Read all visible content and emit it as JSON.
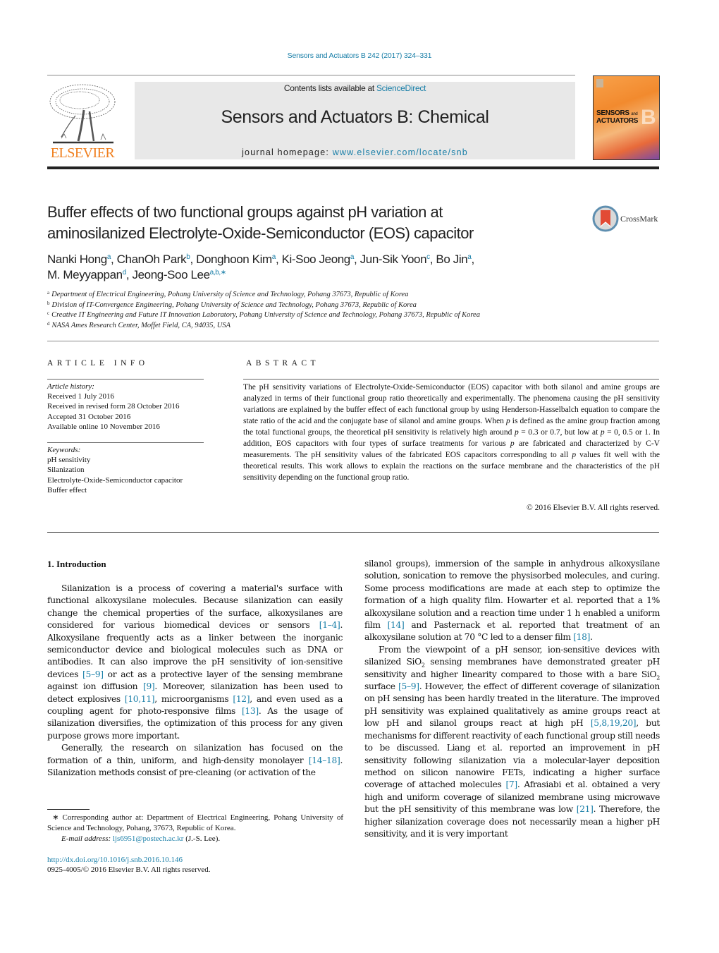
{
  "header": {
    "journal_reference": "Sensors and Actuators B 242 (2017) 324–331",
    "contents_prefix": "Contents lists available at ",
    "contents_link": "ScienceDirect",
    "journal_title": "Sensors and Actuators B: Chemical",
    "homepage_prefix": "journal homepage: ",
    "homepage_link": "www.elsevier.com/locate/snb",
    "publisher_logo_text": "ELSEVIER",
    "cover": {
      "line1": "SENSORS",
      "line1_small": "and",
      "line2": "ACTUATORS",
      "letter": "B"
    },
    "colors": {
      "link": "#1a7fa8",
      "elsevier_orange": "#f07f1e",
      "banner_bg": "#e8e8e8"
    }
  },
  "article": {
    "title_line1": "Buffer effects of two functional groups against pH variation at",
    "title_line2": "aminosilanized Electrolyte-Oxide-Semiconductor (EOS) capacitor",
    "crossmark_label": "CrossMark",
    "authors": [
      {
        "name": "Nanki Hong",
        "aff": "a",
        "sep": ", "
      },
      {
        "name": "ChanOh Park",
        "aff": "b",
        "sep": ", "
      },
      {
        "name": "Donghoon Kim",
        "aff": "a",
        "sep": ", "
      },
      {
        "name": "Ki-Soo Jeong",
        "aff": "a",
        "sep": ", "
      },
      {
        "name": "Jun-Sik Yoon",
        "aff": "c",
        "sep": ", "
      },
      {
        "name": "Bo Jin",
        "aff": "a",
        "sep": ","
      },
      {
        "name": "M. Meyyappan",
        "aff": "d",
        "sep": ", "
      },
      {
        "name": "Jeong-Soo Lee",
        "aff": "a,b,",
        "star": "∗",
        "sep": ""
      }
    ],
    "affiliations": [
      {
        "label": "a",
        "text": "Department of Electrical Engineering, Pohang University of Science and Technology, Pohang 37673, Republic of Korea"
      },
      {
        "label": "b",
        "text": "Division of IT-Convergence Engineering, Pohang University of Science and Technology, Pohang 37673, Republic of Korea"
      },
      {
        "label": "c",
        "text": "Creative IT Engineering and Future IT Innovation Laboratory, Pohang University of Science and Technology, Pohang 37673, Republic of Korea"
      },
      {
        "label": "d",
        "text": "NASA Ames Research Center, Moffet Field, CA, 94035, USA"
      }
    ]
  },
  "article_info": {
    "heading": "ARTICLE INFO",
    "history_label": "Article history:",
    "history": [
      "Received 1 July 2016",
      "Received in revised form 28 October 2016",
      "Accepted 31 October 2016",
      "Available online 10 November 2016"
    ],
    "keywords_label": "Keywords:",
    "keywords": [
      "pH sensitivity",
      "Silanization",
      "Electrolyte-Oxide-Semiconductor capacitor",
      "Buffer effect"
    ]
  },
  "abstract": {
    "heading": "ABSTRACT",
    "parts": [
      "The pH sensitivity variations of Electrolyte-Oxide-Semiconductor (EOS) capacitor with both silanol and amine groups are analyzed in terms of their functional group ratio theoretically and experimentally. The phenomena causing the pH sensitivity variations are explained by the buffer effect of each functional group by using Henderson-Hasselbalch equation to compare the state ratio of the acid and the conjugate base of silanol and amine groups. When ",
      " is defined as the amine group fraction among the total functional groups, the theoretical pH sensitivity is relatively high around ",
      " = 0.3 or 0.7, but low at ",
      " = 0, 0.5 or 1. In addition, EOS capacitors with four types of surface treatments for various ",
      " are fabricated and characterized by C-V measurements. The pH sensitivity values of the fabricated EOS capacitors corresponding to all ",
      " values fit well with the theoretical results. This work allows to explain the reactions on the surface membrane and the characteristics of the pH sensitivity depending on the functional group ratio."
    ],
    "var": "p",
    "copyright": "© 2016 Elsevier B.V. All rights reserved."
  },
  "body": {
    "section_heading": "1.  Introduction",
    "left": {
      "p1": [
        "Silanization is a process of covering a material's surface with functional alkoxysilane molecules. Because silanization can easily change the chemical properties of the surface, alkoxysilanes are considered for various biomedical devices or sensors ",
        "[1–4]",
        ". Alkoxysilane frequently acts as a linker between the inorganic semiconductor device and biological molecules such as DNA or antibodies. It can also improve the pH sensitivity of ion-sensitive devices ",
        "[5–9]",
        " or act as a protective layer of the sensing membrane against ion diffusion ",
        "[9]",
        ". Moreover, silanization has been used to detect explosives ",
        "[10,11]",
        ", microorganisms ",
        "[12]",
        ", and even used as a coupling agent for photo-responsive films ",
        "[13]",
        ". As the usage of silanization diversifies, the optimization of this process for any given purpose grows more important."
      ],
      "p2": [
        "Generally, the research on silanization has focused on the formation of a thin, uniform, and high-density monolayer ",
        "[14–18]",
        ". Silanization methods consist of pre-cleaning (or activation of the"
      ]
    },
    "right": {
      "p1": [
        "silanol groups), immersion of the sample in anhydrous alkoxysilane solution, sonication to remove the physisorbed molecules, and curing. Some process modifications are made at each step to optimize the formation of a high quality film. Howarter et al. reported that a 1% alkoxysilane solution and a reaction time under 1 h enabled a uniform film ",
        "[14]",
        " and Pasternack et al. reported that treatment of an alkoxysilane solution at 70 °C led to a denser film ",
        "[18]",
        "."
      ],
      "p2": [
        "From the viewpoint of a pH sensor, ion-sensitive devices with silanized SiO",
        "2",
        " sensing membranes have demonstrated greater pH sensitivity and higher linearity compared to those with a bare SiO",
        "2",
        " surface ",
        "[5–9]",
        ". However, the effect of different coverage of silanization on pH sensing has been hardly treated in the literature. The improved pH sensitivity was explained qualitatively as amine groups react at low pH and silanol groups react at high pH ",
        "[5,8,19,20]",
        ", but mechanisms for different reactivity of each functional group still needs to be discussed. Liang et al. reported an improvement in pH sensitivity following silanization via a molecular-layer deposition method on silicon nanowire FETs, indicating a higher surface coverage of attached molecules ",
        "[7]",
        ". Afrasiabi et al. obtained a very high and uniform coverage of silanized membrane using microwave but the pH sensitivity of this membrane was low ",
        "[21]",
        ". Therefore, the higher silanization coverage does not necessarily mean a higher pH sensitivity, and it is very important"
      ]
    }
  },
  "footnote": {
    "star": "∗",
    "corresponding": " Corresponding author at: Department of Electrical Engineering, Pohang University of Science and Technology, Pohang, 37673, Republic of Korea.",
    "email_label": "E-mail address:",
    "email": "ljs6951@postech.ac.kr",
    "email_suffix": " (J.-S. Lee).",
    "doi": "http://dx.doi.org/10.1016/j.snb.2016.10.146",
    "issn": "0925-4005/© 2016 Elsevier B.V. All rights reserved."
  }
}
